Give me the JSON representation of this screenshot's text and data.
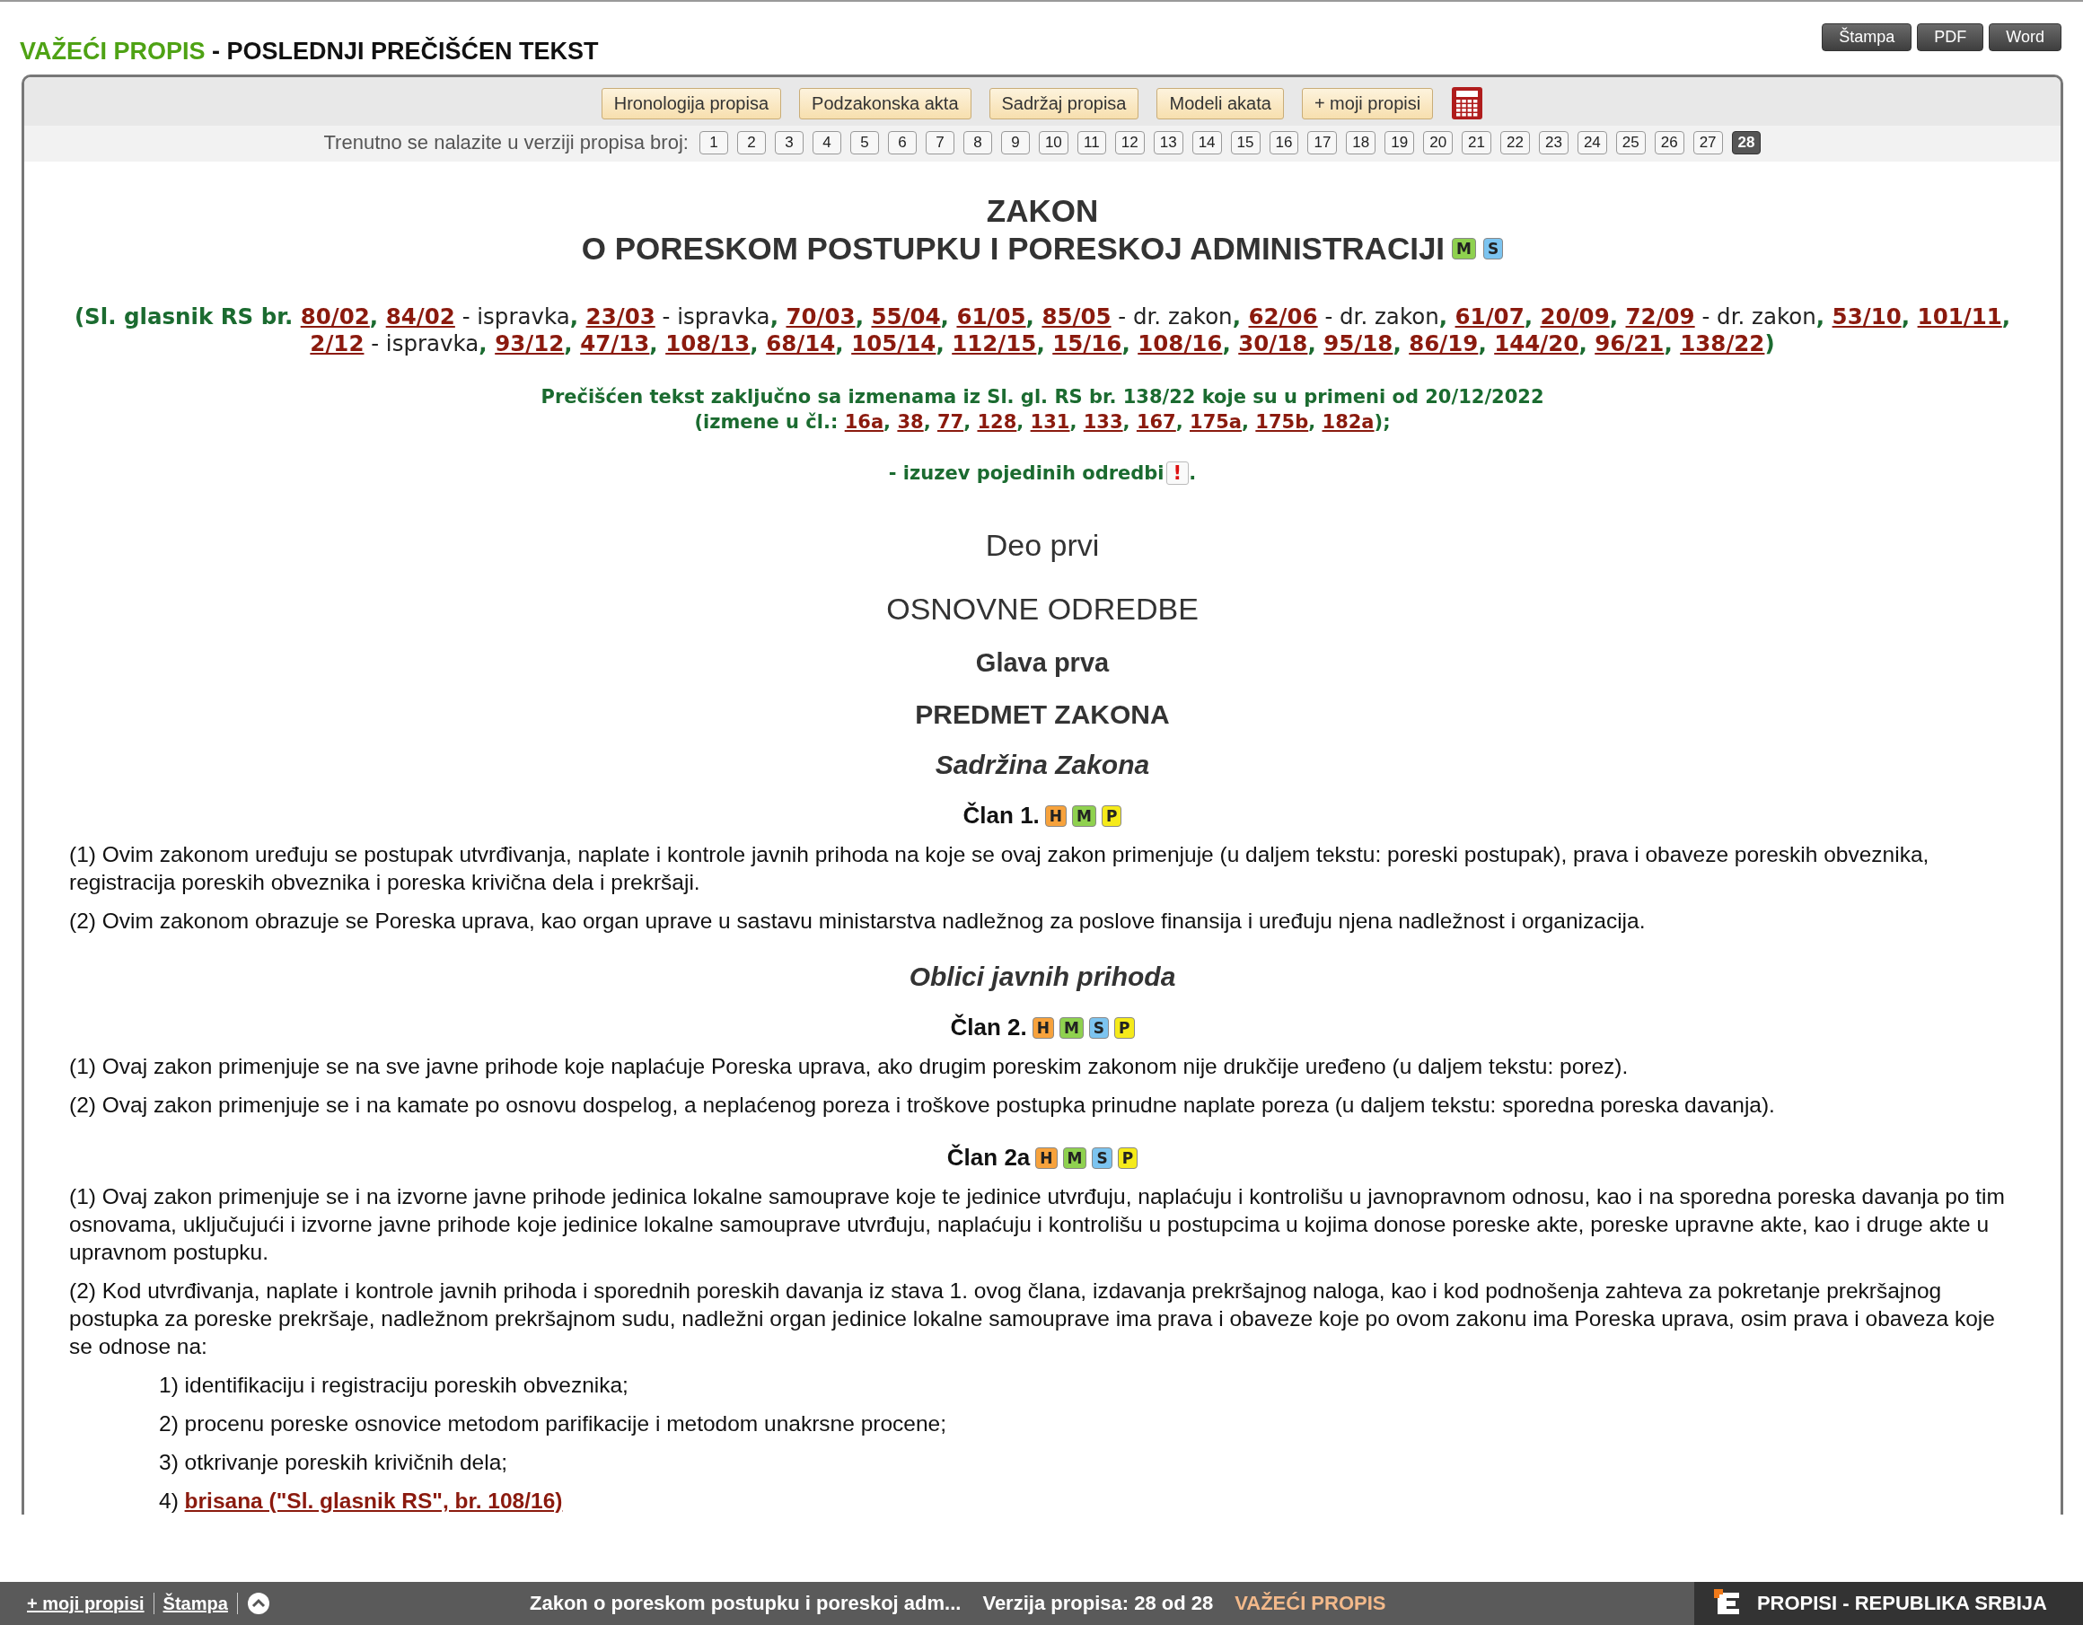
{
  "header": {
    "status": "VAŽEĆI PROPIS",
    "title": " - POSLEDNJI PREČIŠĆEN TEKST",
    "actions": [
      "Štampa",
      "PDF",
      "Word"
    ]
  },
  "nav_buttons": [
    "Hronologija propisa",
    "Podzakonska akta",
    "Sadržaj propisa",
    "Modeli akata",
    "+ moji propisi"
  ],
  "versions": {
    "label": "Trenutno se nalazite u verziji propisa broj:",
    "items": [
      {
        "label": "1",
        "selected": false
      },
      {
        "label": "2",
        "selected": false
      },
      {
        "label": "3",
        "selected": false
      },
      {
        "label": "4",
        "selected": false
      },
      {
        "label": "5",
        "selected": false
      },
      {
        "label": "6",
        "selected": false
      },
      {
        "label": "7",
        "selected": false
      },
      {
        "label": "8",
        "selected": false
      },
      {
        "label": "9",
        "selected": false
      },
      {
        "label": "10",
        "selected": false
      },
      {
        "label": "11",
        "selected": false
      },
      {
        "label": "12",
        "selected": false
      },
      {
        "label": "13",
        "selected": false
      },
      {
        "label": "14",
        "selected": false
      },
      {
        "label": "15",
        "selected": false
      },
      {
        "label": "16",
        "selected": false
      },
      {
        "label": "17",
        "selected": false
      },
      {
        "label": "18",
        "selected": false
      },
      {
        "label": "19",
        "selected": false
      },
      {
        "label": "20",
        "selected": false
      },
      {
        "label": "21",
        "selected": false
      },
      {
        "label": "22",
        "selected": false
      },
      {
        "label": "23",
        "selected": false
      },
      {
        "label": "24",
        "selected": false
      },
      {
        "label": "25",
        "selected": false
      },
      {
        "label": "26",
        "selected": false
      },
      {
        "label": "27",
        "selected": false
      },
      {
        "label": "28",
        "selected": true
      }
    ]
  },
  "document": {
    "title": [
      "ZAKON",
      "O PORESKOM POSTUPKU I PORESKOJ ADMINISTRACIJI"
    ],
    "title_badges": [
      {
        "text": "M",
        "color": "#8fd14f"
      },
      {
        "text": "S",
        "color": "#7cc4f0"
      }
    ],
    "citation": {
      "open": "(Sl. glasnik RS br. ",
      "sep": ", ",
      "close": ")",
      "refs": [
        {
          "text": "80/02"
        },
        {
          "text": "84/02",
          "note": " - ispravka"
        },
        {
          "text": "23/03",
          "note": " - ispravka"
        },
        {
          "text": "70/03"
        },
        {
          "text": "55/04"
        },
        {
          "text": "61/05"
        },
        {
          "text": "85/05",
          "note": " - dr. zakon"
        },
        {
          "text": "62/06",
          "note": " - dr. zakon"
        },
        {
          "text": "61/07"
        },
        {
          "text": "20/09"
        },
        {
          "text": "72/09",
          "note": " - dr. zakon"
        },
        {
          "text": "53/10"
        },
        {
          "text": "101/11"
        },
        {
          "text": "2/12",
          "note": " - ispravka"
        },
        {
          "text": "93/12"
        },
        {
          "text": "47/13"
        },
        {
          "text": "108/13"
        },
        {
          "text": "68/14"
        },
        {
          "text": "105/14"
        },
        {
          "text": "112/15"
        },
        {
          "text": "15/16"
        },
        {
          "text": "108/16"
        },
        {
          "text": "30/18"
        },
        {
          "text": "95/18"
        },
        {
          "text": "86/19"
        },
        {
          "text": "144/20"
        },
        {
          "text": "96/21"
        },
        {
          "text": "138/22"
        }
      ]
    },
    "consolidated": {
      "lead": "Prečišćen tekst zaključno sa izmenama iz Sl. gl. RS br. 138/22  koje su u primeni od 20/12/2022",
      "open": "(izmene u čl.: ",
      "sep": ", ",
      "close": ");",
      "refs": [
        "16a",
        "38",
        "77",
        "128",
        "131",
        "133",
        "167",
        "175a",
        "175b",
        "182a"
      ]
    },
    "exception": {
      "text": "- izuzev pojedinih odredbi ",
      "badge": "!",
      "end": "."
    },
    "blocks": [
      {
        "kind": "part",
        "text": "Deo prvi"
      },
      {
        "kind": "section",
        "text": "OSNOVNE ODREDBE"
      },
      {
        "kind": "chapter",
        "text": "Glava prva"
      },
      {
        "kind": "heading",
        "text": "PREDMET ZAKONA"
      },
      {
        "kind": "subtitle",
        "text": "Sadržina Zakona"
      },
      {
        "kind": "article",
        "text": "Član 1.",
        "badges": [
          {
            "text": "H",
            "color": "#f7a23c"
          },
          {
            "text": "M",
            "color": "#8fd14f"
          },
          {
            "text": "P",
            "color": "#f5ea1a"
          }
        ]
      },
      {
        "kind": "paragraph",
        "text": "(1) Ovim zakonom uređuju se postupak utvrđivanja, naplate i kontrole javnih prihoda na koje se ovaj zakon primenjuje (u daljem tekstu: poreski postupak), prava i obaveze poreskih obveznika, registracija poreskih obveznika i poreska krivična dela i prekršaji."
      },
      {
        "kind": "paragraph",
        "text": "(2) Ovim zakonom obrazuje se Poreska uprava, kao organ uprave u sastavu ministarstva nadležnog za poslove finansija i uređuju njena nadležnost i organizacija."
      },
      {
        "kind": "subtitle",
        "text": "Oblici javnih prihoda"
      },
      {
        "kind": "article",
        "text": "Član 2.",
        "badges": [
          {
            "text": "H",
            "color": "#f7a23c"
          },
          {
            "text": "M",
            "color": "#8fd14f"
          },
          {
            "text": "S",
            "color": "#7cc4f0"
          },
          {
            "text": "P",
            "color": "#f5ea1a"
          }
        ]
      },
      {
        "kind": "paragraph",
        "text": "(1) Ovaj zakon primenjuje se na sve javne prihode koje naplaćuje Poreska uprava, ako drugim poreskim zakonom nije drukčije uređeno (u daljem tekstu: porez)."
      },
      {
        "kind": "paragraph",
        "text": "(2) Ovaj zakon primenjuje se i na kamate po osnovu dospelog, a neplaćenog poreza i troškove postupka prinudne naplate poreza (u daljem tekstu: sporedna poreska davanja)."
      },
      {
        "kind": "article",
        "text": "Član 2a",
        "badges": [
          {
            "text": "H",
            "color": "#f7a23c"
          },
          {
            "text": "M",
            "color": "#8fd14f"
          },
          {
            "text": "S",
            "color": "#7cc4f0"
          },
          {
            "text": "P",
            "color": "#f5ea1a"
          }
        ]
      },
      {
        "kind": "paragraph",
        "text": "(1) Ovaj zakon primenjuje se i na izvorne javne prihode jedinica lokalne samouprave koje te jedinice utvrđuju, naplaćuju i kontrolišu u javnopravnom odnosu, kao i na sporedna poreska davanja po tim osnovama, uključujući i izvorne javne prihode koje jedinice lokalne samouprave utvrđuju, naplaćuju i kontrolišu u postupcima u kojima donose poreske akte, poreske upravne akte, kao i druge akte u upravnom postupku."
      },
      {
        "kind": "paragraph",
        "text": "(2) Kod utvrđivanja, naplate i kontrole javnih prihoda i sporednih poreskih davanja iz stava 1. ovog člana, izdavanja prekršajnog naloga, kao i kod podnošenja zahteva za pokretanje prekršajnog postupka za poreske prekršaje, nadležnom prekršajnom sudu, nadležni organ jedinice lokalne samouprave ima prava i obaveze koje po ovom zakonu ima Poreska uprava, osim prava i obaveza koje se odnose na:"
      },
      {
        "kind": "item",
        "text": "1) identifikaciju i registraciju poreskih obveznika;"
      },
      {
        "kind": "item",
        "text": "2) procenu poreske osnovice metodom parifikacije i metodom unakrsne procene;"
      },
      {
        "kind": "item",
        "text": "3) otkrivanje poreskih krivičnih dela;"
      },
      {
        "kind": "item_link",
        "text": "4) ",
        "link": "brisana (\"Sl. glasnik RS\", br. 108/16)"
      }
    ]
  },
  "footer": {
    "links": [
      "+ moji propisi",
      "Štampa"
    ],
    "doc_title": "Zakon o poreskom postupku i poreskoj adm...",
    "version": "Verzija propisa: 28 od 28",
    "status": "VAŽEĆI PROPIS",
    "brand": "PROPISI - REPUBLIKA SRBIJA"
  }
}
